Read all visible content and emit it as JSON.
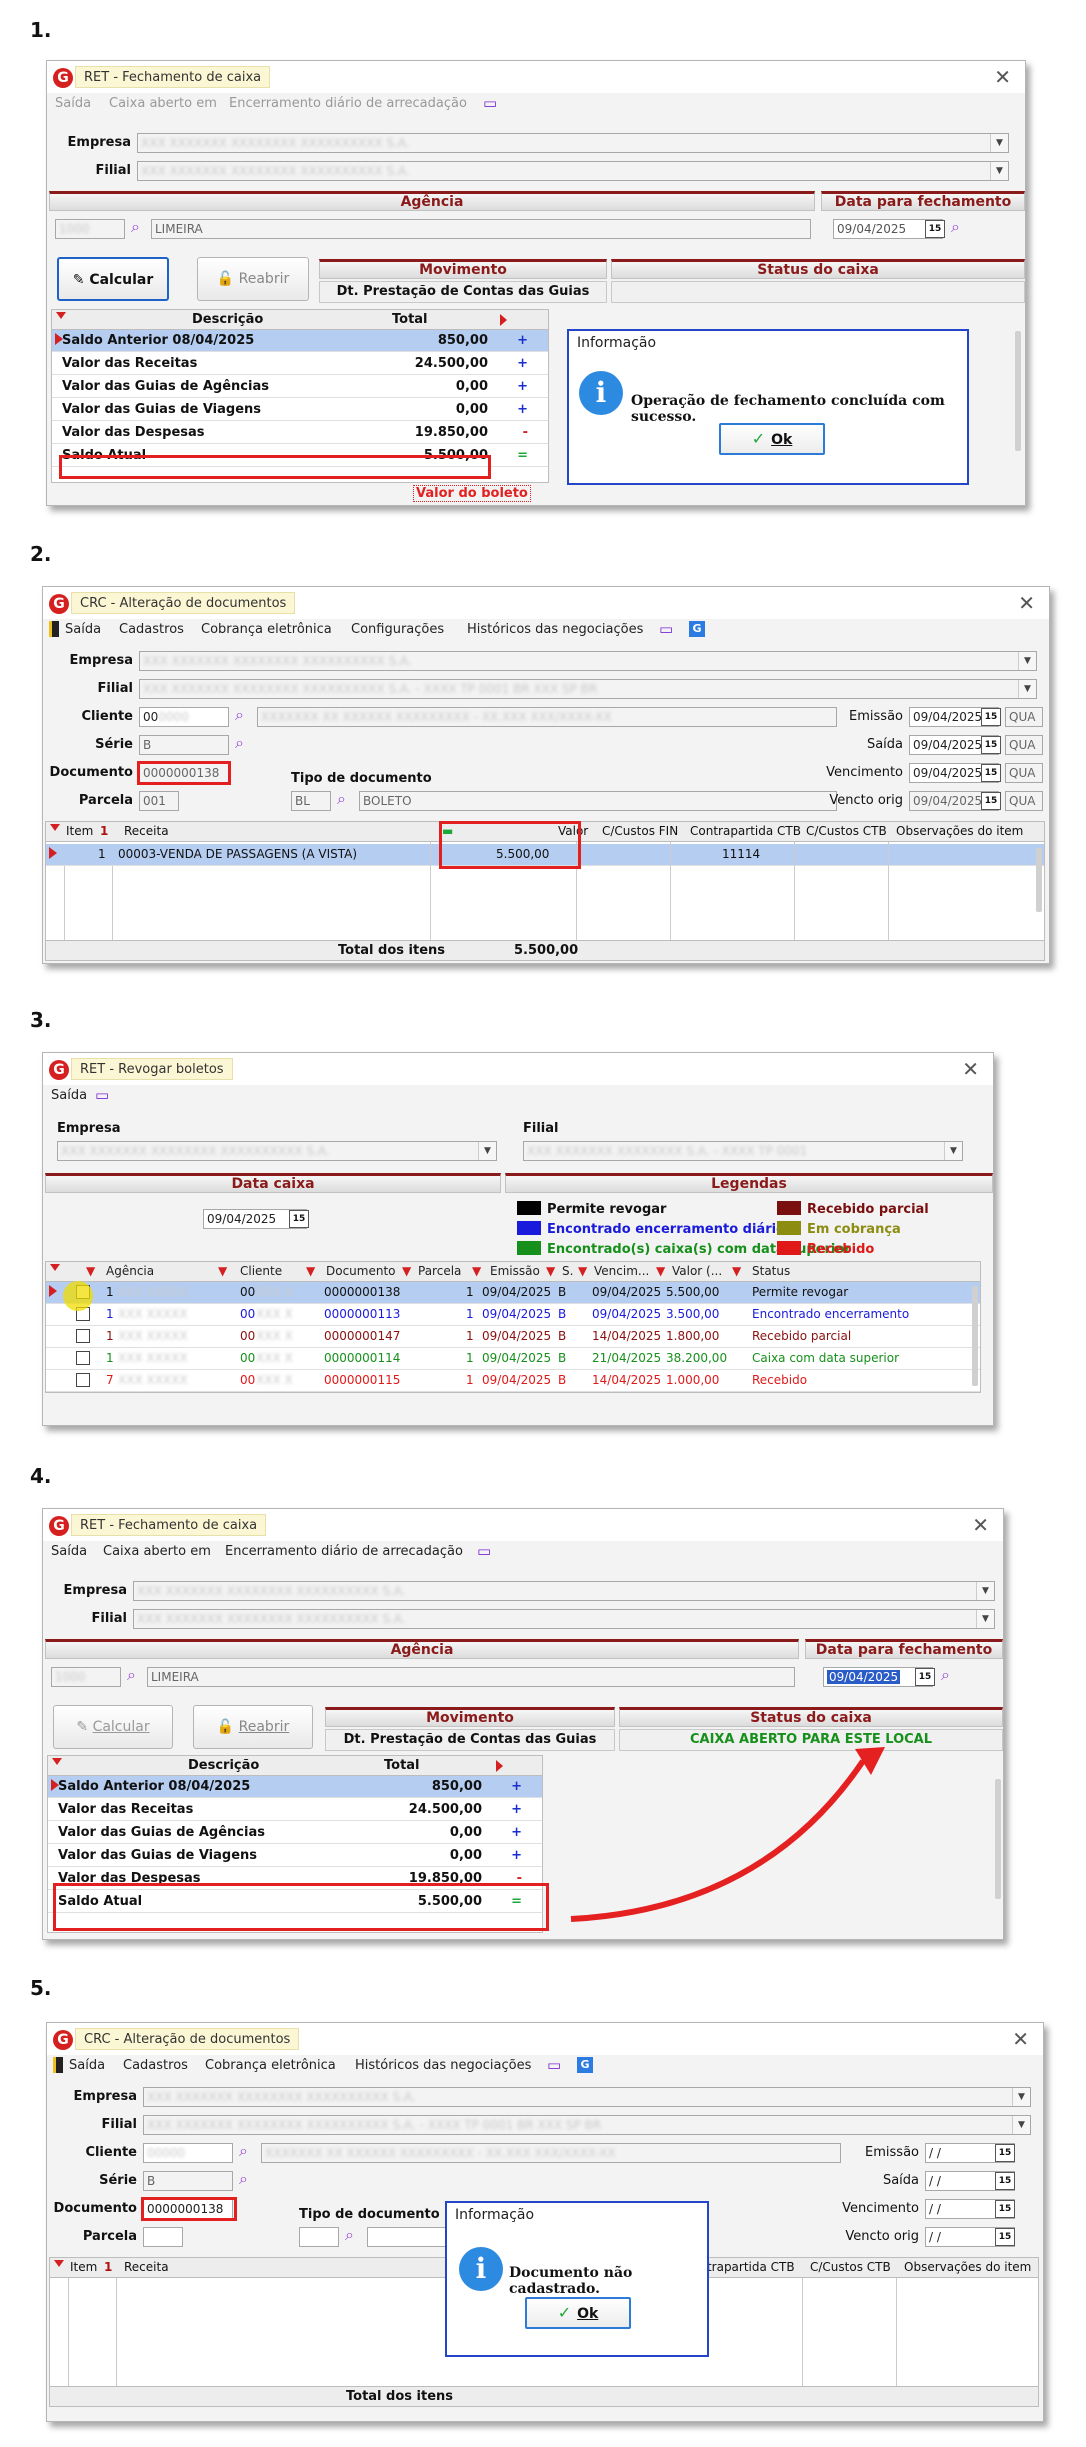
{
  "steps": [
    "1.",
    "2.",
    "3.",
    "4.",
    "5."
  ],
  "s1": {
    "title": "RET - Fechamento de caixa",
    "menu": [
      "Saída",
      "Caixa aberto em",
      "Encerramento diário de arrecadação"
    ],
    "empresa_label": "Empresa",
    "filial_label": "Filial",
    "agencia_header": "Agência",
    "data_header": "Data para fechamento",
    "agencia_name": "LIMEIRA",
    "date": "09/04/2025",
    "btn_calcular": "Calcular",
    "btn_reabrir": "Reabrir",
    "movimento_header": "Movimento",
    "movimento_value": "Dt. Prestação de Contas das Guias",
    "status_header": "Status do caixa",
    "col_desc": "Descrição",
    "col_total": "Total",
    "rows": [
      {
        "desc": "Saldo Anterior  08/04/2025",
        "total": "850,00",
        "sign": "+"
      },
      {
        "desc": "Valor das Receitas",
        "total": "24.500,00",
        "sign": "+"
      },
      {
        "desc": "Valor das Guias de Agências",
        "total": "0,00",
        "sign": "+"
      },
      {
        "desc": "Valor das Guias de Viagens",
        "total": "0,00",
        "sign": "+"
      },
      {
        "desc": "Valor das Despesas",
        "total": "19.850,00",
        "sign": "-"
      },
      {
        "desc": "Saldo Atual",
        "total": "5.500,00",
        "sign": "="
      }
    ],
    "valor_boleto": "Valor do boleto",
    "dialog_title": "Informação",
    "dialog_msg": "Operação de fechamento concluída com sucesso.",
    "ok": "Ok"
  },
  "s2": {
    "title": "CRC - Alteração de documentos",
    "menu": [
      "Saída",
      "Cadastros",
      "Cobrança eletrônica",
      "Configurações",
      "Históricos das negociações"
    ],
    "empresa_label": "Empresa",
    "filial_label": "Filial",
    "cliente_label": "Cliente",
    "cliente_code": "00",
    "serie_label": "Série",
    "serie_value": "B",
    "documento_label": "Documento",
    "documento_value": "0000000138",
    "parcela_label": "Parcela",
    "parcela_value": "001",
    "tipo_label": "Tipo de documento",
    "tipo_code": "BL",
    "tipo_name": "BOLETO",
    "emissao_label": "Emissão",
    "saida_label": "Saída",
    "vencimento_label": "Vencimento",
    "vencto_label": "Vencto orig",
    "date": "09/04/2025",
    "weekday": "QUA",
    "cols": [
      "Item",
      "Receita",
      "Valor",
      "C/Custos FIN",
      "Contrapartida CTB",
      "C/Custos CTB",
      "Observações do item"
    ],
    "row": {
      "item": "1",
      "receita": "00003-VENDA DE PASSAGENS (A VISTA)",
      "valor": "5.500,00",
      "contrapartida": "11114"
    },
    "total_label": "Total dos itens",
    "total_value": "5.500,00"
  },
  "s3": {
    "title": "RET - Revogar boletos",
    "menu": [
      "Saída"
    ],
    "empresa_label": "Empresa",
    "filial_label": "Filial",
    "data_header": "Data caixa",
    "date": "09/04/2025",
    "legend_header": "Legendas",
    "legend": [
      {
        "label": "Permite revogar",
        "color": "#000000"
      },
      {
        "label": "Encontrado encerramento diário",
        "color": "#1a1adc"
      },
      {
        "label": "Encontrado(s) caixa(s) com data superior",
        "color": "#16901a"
      },
      {
        "label": "Recebido parcial",
        "color": "#7a0f0f"
      },
      {
        "label": "Em cobrança",
        "color": "#8c8c10"
      },
      {
        "label": "Recebido",
        "color": "#e01818"
      }
    ],
    "cols": [
      "Agência",
      "Cliente",
      "Documento",
      "Parcela",
      "Emissão",
      "S.",
      "Vencim...",
      "Valor (...",
      "Status"
    ],
    "rows": [
      {
        "ag": "1",
        "cli": "00",
        "doc": "0000000138",
        "par": "1",
        "emi": "09/04/2025",
        "s": "B",
        "ven": "09/04/2025",
        "val": "5.500,00",
        "status": "Permite revogar",
        "color": "#111111"
      },
      {
        "ag": "1",
        "cli": "00",
        "doc": "0000000113",
        "par": "1",
        "emi": "09/04/2025",
        "s": "B",
        "ven": "09/04/2025",
        "val": "3.500,00",
        "status": "Encontrado encerramento",
        "color": "#1a1adc"
      },
      {
        "ag": "1",
        "cli": "00",
        "doc": "0000000147",
        "par": "1",
        "emi": "09/04/2025",
        "s": "B",
        "ven": "14/04/2025",
        "val": "1.800,00",
        "status": "Recebido parcial",
        "color": "#8b1010"
      },
      {
        "ag": "1",
        "cli": "00",
        "doc": "0000000114",
        "par": "1",
        "emi": "09/04/2025",
        "s": "B",
        "ven": "21/04/2025",
        "val": "38.200,00",
        "status": "Caixa com data superior",
        "color": "#16901a"
      },
      {
        "ag": "7",
        "cli": "00",
        "doc": "0000000115",
        "par": "1",
        "emi": "09/04/2025",
        "s": "B",
        "ven": "14/04/2025",
        "val": "1.000,00",
        "status": "Recebido",
        "color": "#e01818"
      }
    ]
  },
  "s4": {
    "title": "RET - Fechamento de caixa",
    "menu": [
      "Saída",
      "Caixa aberto em",
      "Encerramento diário de arrecadação"
    ],
    "empresa_label": "Empresa",
    "filial_label": "Filial",
    "agencia_header": "Agência",
    "data_header": "Data para fechamento",
    "agencia_name": "LIMEIRA",
    "date": "09/04/2025",
    "btn_calcular": "Calcular",
    "btn_reabrir": "Reabrir",
    "movimento_header": "Movimento",
    "movimento_value": "Dt. Prestação de Contas das Guias",
    "status_header": "Status do caixa",
    "status_value": "CAIXA ABERTO PARA ESTE LOCAL",
    "col_desc": "Descrição",
    "col_total": "Total",
    "rows": [
      {
        "desc": "Saldo Anterior  08/04/2025",
        "total": "850,00",
        "sign": "+"
      },
      {
        "desc": "Valor das Receitas",
        "total": "24.500,00",
        "sign": "+"
      },
      {
        "desc": "Valor das Guias de Agências",
        "total": "0,00",
        "sign": "+"
      },
      {
        "desc": "Valor das Guias de Viagens",
        "total": "0,00",
        "sign": "+"
      },
      {
        "desc": "Valor das Despesas",
        "total": "19.850,00",
        "sign": "-"
      },
      {
        "desc": "Saldo Atual",
        "total": "5.500,00",
        "sign": "="
      }
    ]
  },
  "s5": {
    "title": "CRC - Alteração de documentos",
    "menu": [
      "Saída",
      "Cadastros",
      "Cobrança eletrônica",
      "Históricos das negociações"
    ],
    "empresa_label": "Empresa",
    "filial_label": "Filial",
    "cliente_label": "Cliente",
    "serie_label": "Série",
    "serie_value": "B",
    "documento_label": "Documento",
    "documento_value": "0000000138",
    "parcela_label": "Parcela",
    "tipo_label": "Tipo de documento",
    "emissao_label": "Emissão",
    "saida_label": "Saída",
    "vencimento_label": "Vencimento",
    "vencto_label": "Vencto orig",
    "empty_date": " / /",
    "cols": [
      "Item",
      "Receita",
      "ontrapartida CTB",
      "C/Custos CTB",
      "Observações do item"
    ],
    "total_label": "Total dos itens",
    "dialog_title": "Informação",
    "dialog_msg": "Documento não cadastrado.",
    "ok": "Ok"
  },
  "colors": {
    "accent_red": "#8b1a1a",
    "highlight_box": "#e32020",
    "selection": "#b5cdf0",
    "dialog_border": "#2545c8",
    "open_status": "#16901a"
  }
}
